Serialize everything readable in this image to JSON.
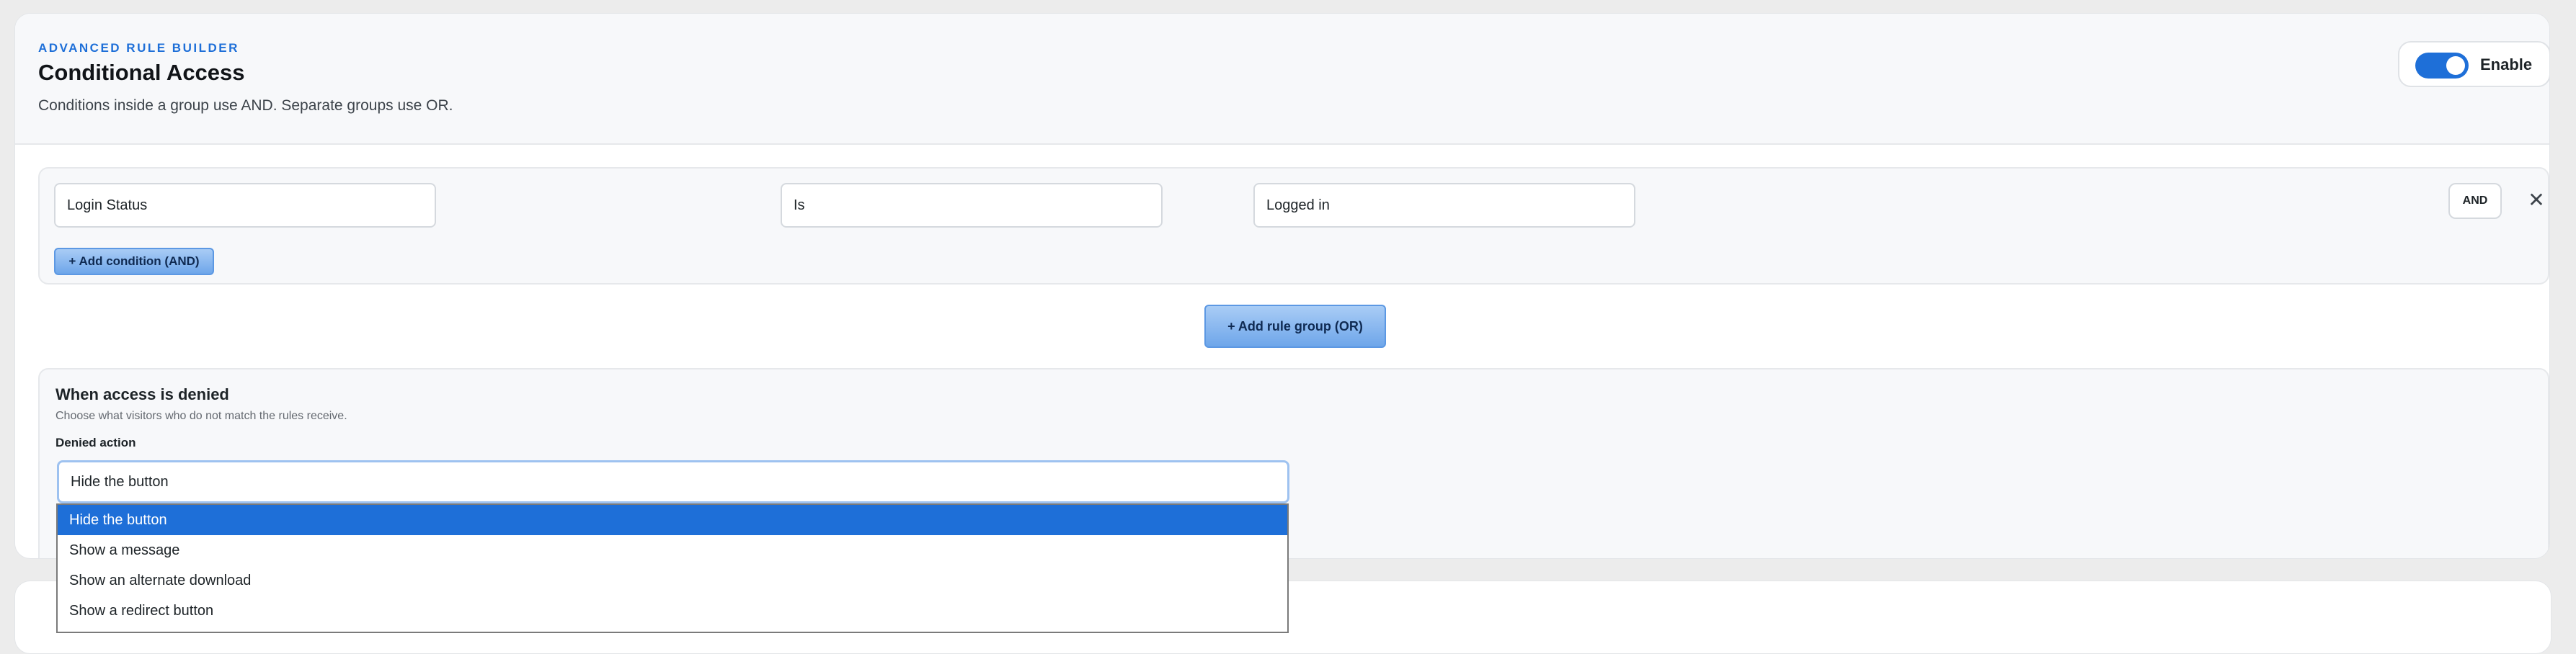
{
  "header": {
    "eyebrow": "ADVANCED RULE BUILDER",
    "title": "Conditional Access",
    "subtitle": "Conditions inside a group use AND. Separate groups use OR.",
    "toggle": {
      "label": "Enable",
      "on": true
    }
  },
  "rule_group": {
    "condition": {
      "field": "Login Status",
      "operator": "Is",
      "value": "Logged in"
    },
    "logic_badge": "AND",
    "remove_icon": "close-icon",
    "add_condition_label": "+ Add condition (AND)"
  },
  "add_group_label": "+  Add rule group (OR)",
  "denied": {
    "title": "When access is denied",
    "description": "Choose what visitors who do not match the rules receive.",
    "label": "Denied action",
    "selected": "Hide the button",
    "options": [
      "Hide the button",
      "Show a message",
      "Show an alternate download",
      "Show a redirect button"
    ]
  },
  "colors": {
    "accent": "#1e6fd8",
    "button_gradient_top": "#a9ccf5",
    "button_gradient_bottom": "#6ea6ea"
  }
}
